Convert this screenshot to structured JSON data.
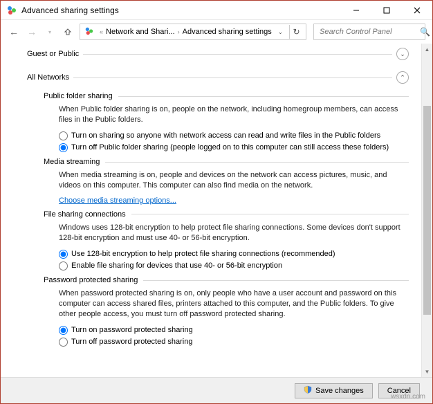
{
  "window": {
    "title": "Advanced sharing settings"
  },
  "nav": {
    "breadcrumb": {
      "seg1": "Network and Shari...",
      "seg2": "Advanced sharing settings"
    },
    "search_placeholder": "Search Control Panel"
  },
  "profiles": {
    "guest": "Guest or Public",
    "all": "All Networks"
  },
  "sections": {
    "pfs": {
      "title": "Public folder sharing",
      "desc": "When Public folder sharing is on, people on the network, including homegroup members, can access files in the Public folders.",
      "opt_on": "Turn on sharing so anyone with network access can read and write files in the Public folders",
      "opt_off": "Turn off Public folder sharing (people logged on to this computer can still access these folders)"
    },
    "media": {
      "title": "Media streaming",
      "desc": "When media streaming is on, people and devices on the network can access pictures, music, and videos on this computer. This computer can also find media on the network.",
      "link": "Choose media streaming options..."
    },
    "fse": {
      "title": "File sharing connections",
      "desc": "Windows uses 128-bit encryption to help protect file sharing connections. Some devices don't support 128-bit encryption and must use 40- or 56-bit encryption.",
      "opt128": "Use 128-bit encryption to help protect file sharing connections (recommended)",
      "opt40": "Enable file sharing for devices that use 40- or 56-bit encryption"
    },
    "pps": {
      "title": "Password protected sharing",
      "desc": "When password protected sharing is on, only people who have a user account and password on this computer can access shared files, printers attached to this computer, and the Public folders. To give other people access, you must turn off password protected sharing.",
      "opt_on": "Turn on password protected sharing",
      "opt_off": "Turn off password protected sharing"
    }
  },
  "footer": {
    "save": "Save changes",
    "cancel": "Cancel"
  },
  "watermark": "wsxdn.com"
}
